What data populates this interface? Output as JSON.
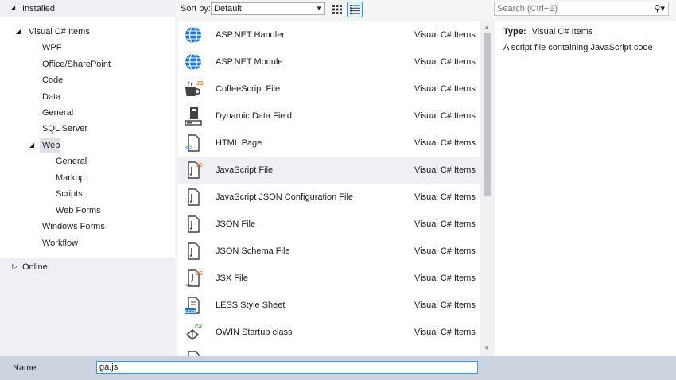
{
  "tree": {
    "installed_label": "Installed",
    "root_label": "Visual C# Items",
    "items": [
      "WPF",
      "Office/SharePoint",
      "Code",
      "Data",
      "General",
      "SQL Server"
    ],
    "web_label": "Web",
    "web_children": [
      "General",
      "Markup",
      "Scripts",
      "Web Forms"
    ],
    "after_web": [
      "Windows Forms",
      "Workflow"
    ],
    "online_label": "Online"
  },
  "toolbar": {
    "sort_by_label": "Sort by:",
    "sort_value": "Default"
  },
  "search": {
    "placeholder": "Search (Ctrl+E)"
  },
  "templates": [
    {
      "name": "ASP.NET Handler",
      "category": "Visual C# Items",
      "icon": "globe-icon"
    },
    {
      "name": "ASP.NET Module",
      "category": "Visual C# Items",
      "icon": "globe-icon"
    },
    {
      "name": "CoffeeScript File",
      "category": "Visual C# Items",
      "icon": "coffee-cup-icon"
    },
    {
      "name": "Dynamic Data Field",
      "category": "Visual C# Items",
      "icon": "data-field-icon"
    },
    {
      "name": "HTML Page",
      "category": "Visual C# Items",
      "icon": "html-page-icon"
    },
    {
      "name": "JavaScript File",
      "category": "Visual C# Items",
      "icon": "js-file-icon"
    },
    {
      "name": "JavaScript JSON Configuration File",
      "category": "Visual C# Items",
      "icon": "json-file-icon"
    },
    {
      "name": "JSON File",
      "category": "Visual C# Items",
      "icon": "json-file-icon"
    },
    {
      "name": "JSON Schema File",
      "category": "Visual C# Items",
      "icon": "json-file-icon"
    },
    {
      "name": "JSX File",
      "category": "Visual C# Items",
      "icon": "jsx-file-icon"
    },
    {
      "name": "LESS Style Sheet",
      "category": "Visual C# Items",
      "icon": "less-file-icon"
    },
    {
      "name": "OWIN Startup class",
      "category": "Visual C# Items",
      "icon": "csharp-class-icon"
    }
  ],
  "selected_index": 5,
  "details": {
    "type_label": "Type:",
    "type_value": "Visual C# Items",
    "description": "A script file containing JavaScript code"
  },
  "footer": {
    "name_label": "Name:",
    "name_value": "ga.js"
  },
  "colors": {
    "accent": "#3399ff",
    "js_badge": "#e8762b",
    "globe": "#1e79d6",
    "csharp_badge": "#388a34"
  }
}
